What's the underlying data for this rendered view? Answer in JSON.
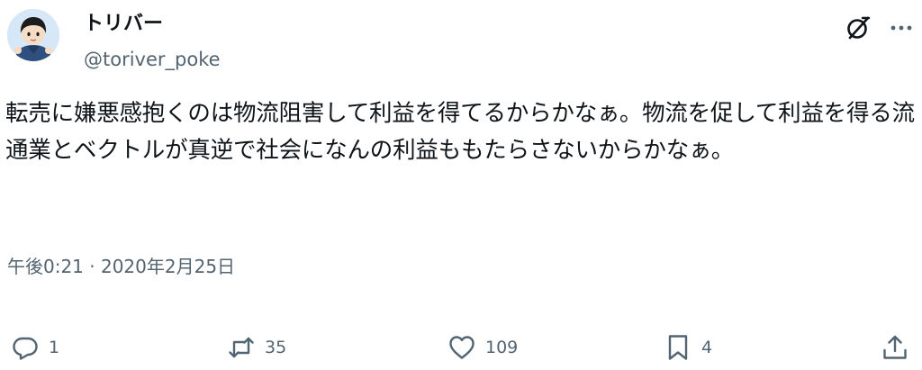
{
  "author": {
    "display_name": "トリバー",
    "handle": "@toriver_poke",
    "avatar": "avatar-illustration"
  },
  "header_icons": {
    "grok": "grok-icon",
    "more": "more-dots-icon"
  },
  "tweet": {
    "text": "転売に嫌悪感抱くのは物流阻害して利益を得てるからかなぁ。物流を促して利益を得る流通業とベクトルが真逆で社会になんの利益ももたらさないからかなぁ。",
    "timestamp": "午後0:21 · 2020年2月25日"
  },
  "actions": {
    "reply": {
      "icon": "reply-icon",
      "count": "1"
    },
    "retweet": {
      "icon": "retweet-icon",
      "count": "35"
    },
    "like": {
      "icon": "heart-icon",
      "count": "109"
    },
    "bookmark": {
      "icon": "bookmark-icon",
      "count": "4"
    },
    "share": {
      "icon": "share-icon"
    }
  },
  "colors": {
    "text": "#0f1419",
    "secondary": "#536471",
    "background": "#ffffff"
  }
}
